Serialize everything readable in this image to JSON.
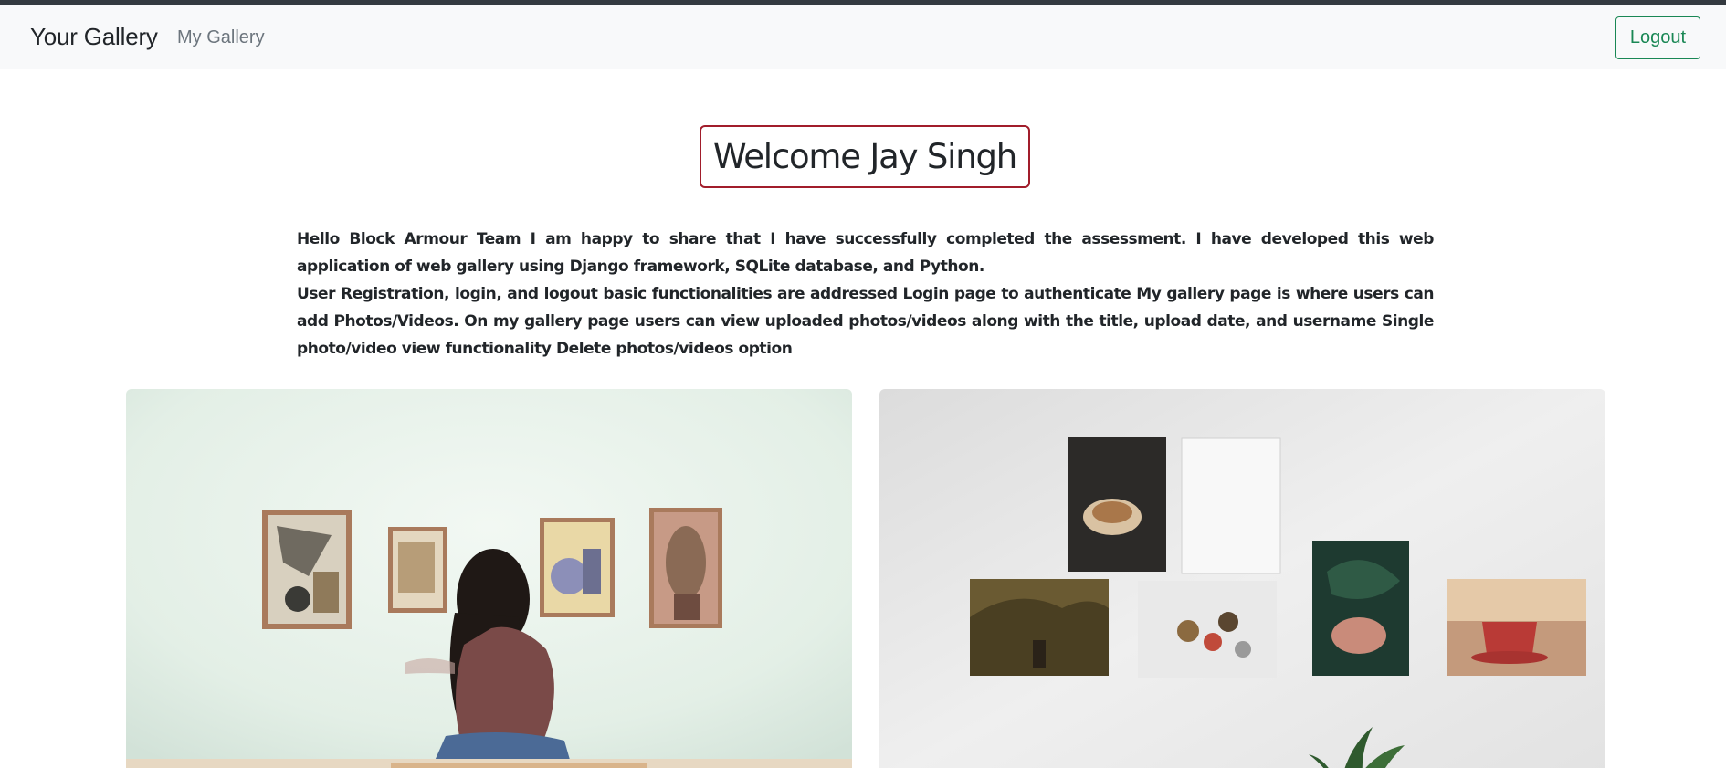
{
  "navbar": {
    "brand": "Your Gallery",
    "nav_link": "My Gallery",
    "logout_label": "Logout"
  },
  "welcome": {
    "title": "Welcome Jay Singh"
  },
  "intro": {
    "paragraph1": "Hello Block Armour Team I am happy to share that I have successfully completed the assessment. I have developed this web application of web gallery using Django framework, SQLite database, and Python.",
    "paragraph2": "User Registration, login, and logout basic functionalities are addressed Login page to authenticate My gallery page is where users can add Photos/Videos. On my gallery page users can view uploaded photos/videos along with the title, upload date, and username Single photo/video view functionality Delete photos/videos option"
  },
  "colors": {
    "navbar_bg": "#f8f9fa",
    "top_strip": "#343a40",
    "logout_accent": "#198754",
    "welcome_border": "#a11d2b"
  }
}
